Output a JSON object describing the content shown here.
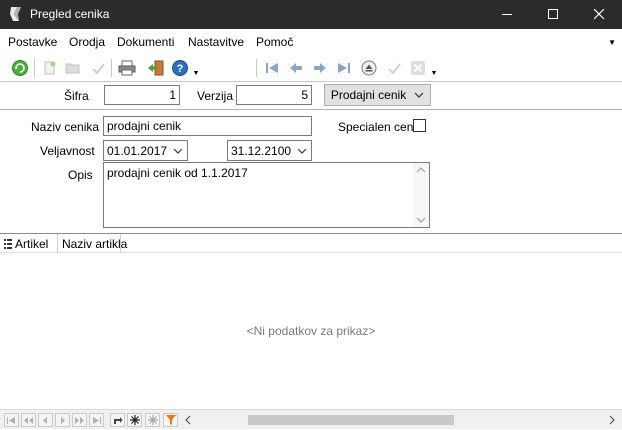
{
  "window": {
    "title": "Pregled cenika",
    "controls": [
      "minimize",
      "maximize",
      "close"
    ]
  },
  "menu": {
    "items": [
      "Postavke",
      "Orodja",
      "Dokumenti",
      "Nastavitve",
      "Pomoč"
    ],
    "overflow_icon": "chevron-down-icon"
  },
  "toolbar": {
    "icons": [
      "refresh-icon",
      "new-document-icon",
      "open-folder-icon",
      "save-check-icon",
      "print-icon",
      "exit-icon",
      "help-icon",
      "first-record-icon",
      "previous-record-icon",
      "next-record-icon",
      "last-record-icon",
      "eject-icon",
      "confirm-icon",
      "cancel-icon"
    ]
  },
  "header": {
    "sifra_label": "Šifra",
    "sifra_value": "1",
    "verzija_label": "Verzija",
    "verzija_value": "5",
    "type_button": "Prodajni cenik"
  },
  "form": {
    "naziv_label": "Naziv cenika",
    "naziv_value": "prodajni cenik",
    "specialen_label": "Specialen cenik",
    "specialen_checked": false,
    "veljavnost_label": "Veljavnost",
    "date_from": "01.01.2017",
    "date_to": "31.12.2100",
    "opis_label": "Opis",
    "opis_value": "prodajni cenik od 1.1.2017"
  },
  "grid": {
    "columns": [
      "Artikel",
      "Naziv artikla"
    ],
    "empty_text": "<Ni podatkov za prikaz>"
  },
  "colors": {
    "titlebar": "#2b2b2b",
    "accent_green": "#3a9a2a",
    "accent_blue": "#2d6fb8",
    "filter_orange": "#e87d0d"
  }
}
